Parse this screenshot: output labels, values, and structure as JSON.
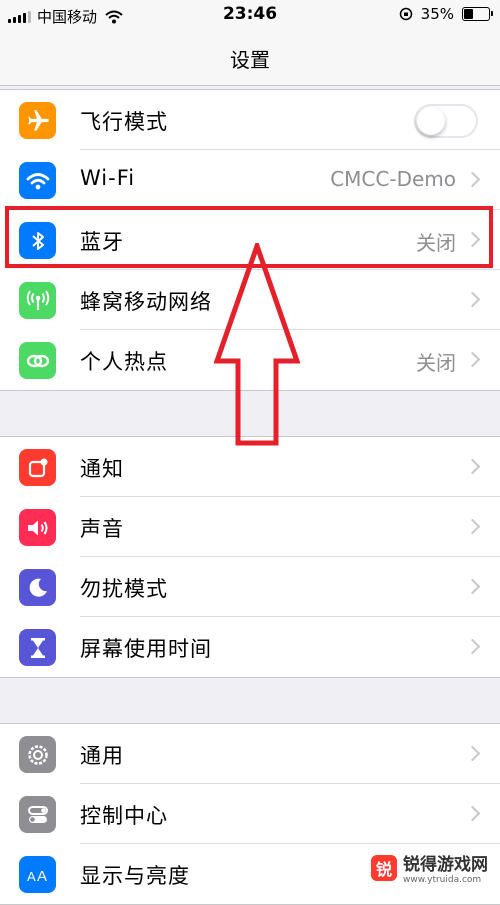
{
  "status_bar": {
    "carrier": "中国移动",
    "time": "23:46",
    "battery_percent": "35%",
    "battery_level": 0.35
  },
  "nav": {
    "title": "设置"
  },
  "groups": [
    {
      "rows": [
        {
          "label": "飞行模式",
          "control": "toggle",
          "toggle_on": false,
          "icon": "airplane-icon",
          "icon_color": "#ff9500"
        },
        {
          "label": "Wi-Fi",
          "value": "CMCC-Demo",
          "icon": "wifi-icon",
          "icon_color": "#007aff"
        },
        {
          "label": "蓝牙",
          "value": "关闭",
          "icon": "bluetooth-icon",
          "icon_color": "#007aff"
        },
        {
          "label": "蜂窝移动网络",
          "icon": "cellular-icon",
          "icon_color": "#4cd964"
        },
        {
          "label": "个人热点",
          "value": "关闭",
          "icon": "hotspot-icon",
          "icon_color": "#4cd964"
        }
      ]
    },
    {
      "rows": [
        {
          "label": "通知",
          "icon": "notifications-icon",
          "icon_color": "#ff3b30"
        },
        {
          "label": "声音",
          "icon": "sounds-icon",
          "icon_color": "#ff2d55"
        },
        {
          "label": "勿扰模式",
          "icon": "do-not-disturb-icon",
          "icon_color": "#5856d6"
        },
        {
          "label": "屏幕使用时间",
          "icon": "screen-time-icon",
          "icon_color": "#5856d6"
        }
      ]
    },
    {
      "rows": [
        {
          "label": "通用",
          "icon": "general-gear-icon",
          "icon_color": "#8e8e93"
        },
        {
          "label": "控制中心",
          "icon": "control-center-icon",
          "icon_color": "#8e8e93"
        },
        {
          "label": "显示与亮度",
          "icon": "display-brightness-icon",
          "icon_color": "#007aff"
        }
      ]
    }
  ],
  "annotation": {
    "highlight_color": "#e4212b",
    "highlighted_row": "蓝牙"
  },
  "watermark": {
    "title": "锐得游戏网",
    "url": "www.ytruida.com",
    "logo_char": "锐"
  }
}
